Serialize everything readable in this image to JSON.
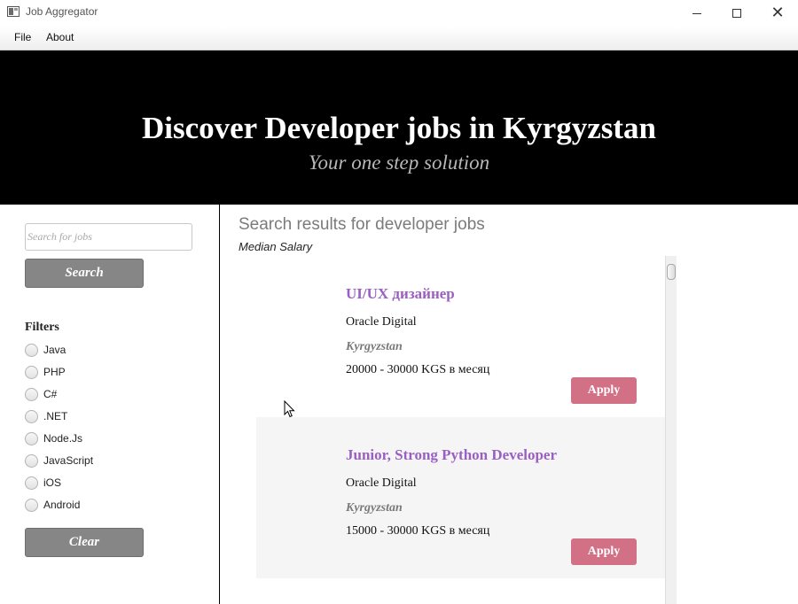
{
  "window": {
    "title": "Job Aggregator",
    "icon": "app-icon",
    "controls": [
      "minimize-icon",
      "maximize-icon",
      "close-icon"
    ]
  },
  "menu": {
    "file": "File",
    "about": "About"
  },
  "hero": {
    "title": "Discover Developer jobs in Kyrgyzstan",
    "subtitle": "Your one step solution",
    "background": "#000000"
  },
  "sidebar": {
    "search_placeholder": "Search for jobs",
    "search_value": "",
    "search_button": "Search",
    "filters_heading": "Filters",
    "filters": [
      {
        "label": "Java",
        "checked": false
      },
      {
        "label": "PHP",
        "checked": false
      },
      {
        "label": "C#",
        "checked": false
      },
      {
        "label": ".NET",
        "checked": false
      },
      {
        "label": "Node.Js",
        "checked": false
      },
      {
        "label": "JavaScript",
        "checked": false
      },
      {
        "label": "iOS",
        "checked": false
      },
      {
        "label": "Android",
        "checked": false
      }
    ],
    "clear_button": "Clear"
  },
  "results": {
    "heading": "Search results for developer jobs",
    "median_salary": "Median Salary",
    "jobs": [
      {
        "title": "UI/UX дизайнер",
        "company": "Oracle Digital",
        "location": "Kyrgyzstan",
        "salary": "20000 - 30000 KGS в месяц",
        "apply": "Apply"
      },
      {
        "title": "Junior, Strong Python Developer",
        "company": "Oracle Digital",
        "location": "Kyrgyzstan",
        "salary": "15000 - 30000 KGS в месяц",
        "apply": "Apply"
      }
    ]
  },
  "colors": {
    "accent_title": "#9a5fc2",
    "apply_button": "#d27186",
    "gray_button": "#868686"
  }
}
